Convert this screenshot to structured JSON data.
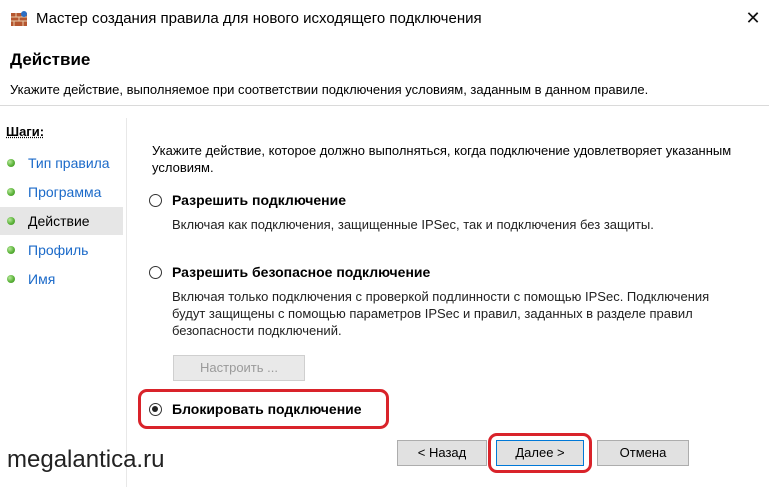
{
  "window": {
    "title": "Мастер создания правила для нового исходящего подключения",
    "close_glyph": "✕"
  },
  "header": {
    "title": "Действие",
    "description": "Укажите действие, выполняемое при соответствии подключения условиям, заданным в данном правиле."
  },
  "sidebar": {
    "heading": "Шаги:",
    "items": [
      {
        "label": "Тип правила",
        "active": false
      },
      {
        "label": "Программа",
        "active": false
      },
      {
        "label": "Действие",
        "active": true
      },
      {
        "label": "Профиль",
        "active": false
      },
      {
        "label": "Имя",
        "active": false
      }
    ]
  },
  "main": {
    "intro": "Укажите действие, которое должно выполняться, когда подключение удовлетворяет указанным условиям.",
    "options": [
      {
        "label": "Разрешить подключение",
        "description": "Включая как подключения, защищенные IPSec, так и подключения без защиты.",
        "selected": false
      },
      {
        "label": "Разрешить безопасное подключение",
        "description": "Включая только подключения с проверкой подлинности с помощью IPSec. Подключения будут защищены с помощью параметров IPSec и правил, заданных в разделе правил безопасности подключений.",
        "selected": false
      },
      {
        "label": "Блокировать подключение",
        "description": "",
        "selected": true
      }
    ],
    "configure_button": "Настроить ..."
  },
  "footer": {
    "back_button": "< Назад",
    "next_button": "Далее >",
    "cancel_button": "Отмена"
  },
  "watermark": "megalantica.ru",
  "colors": {
    "highlight": "#d9232a",
    "link": "#1b6ac9",
    "step_dot": "#5cb33a",
    "primary_border": "#0078d7"
  },
  "icons": {
    "app": "firewall-wall-icon",
    "close": "close-icon",
    "step": "green-bullet-icon"
  }
}
